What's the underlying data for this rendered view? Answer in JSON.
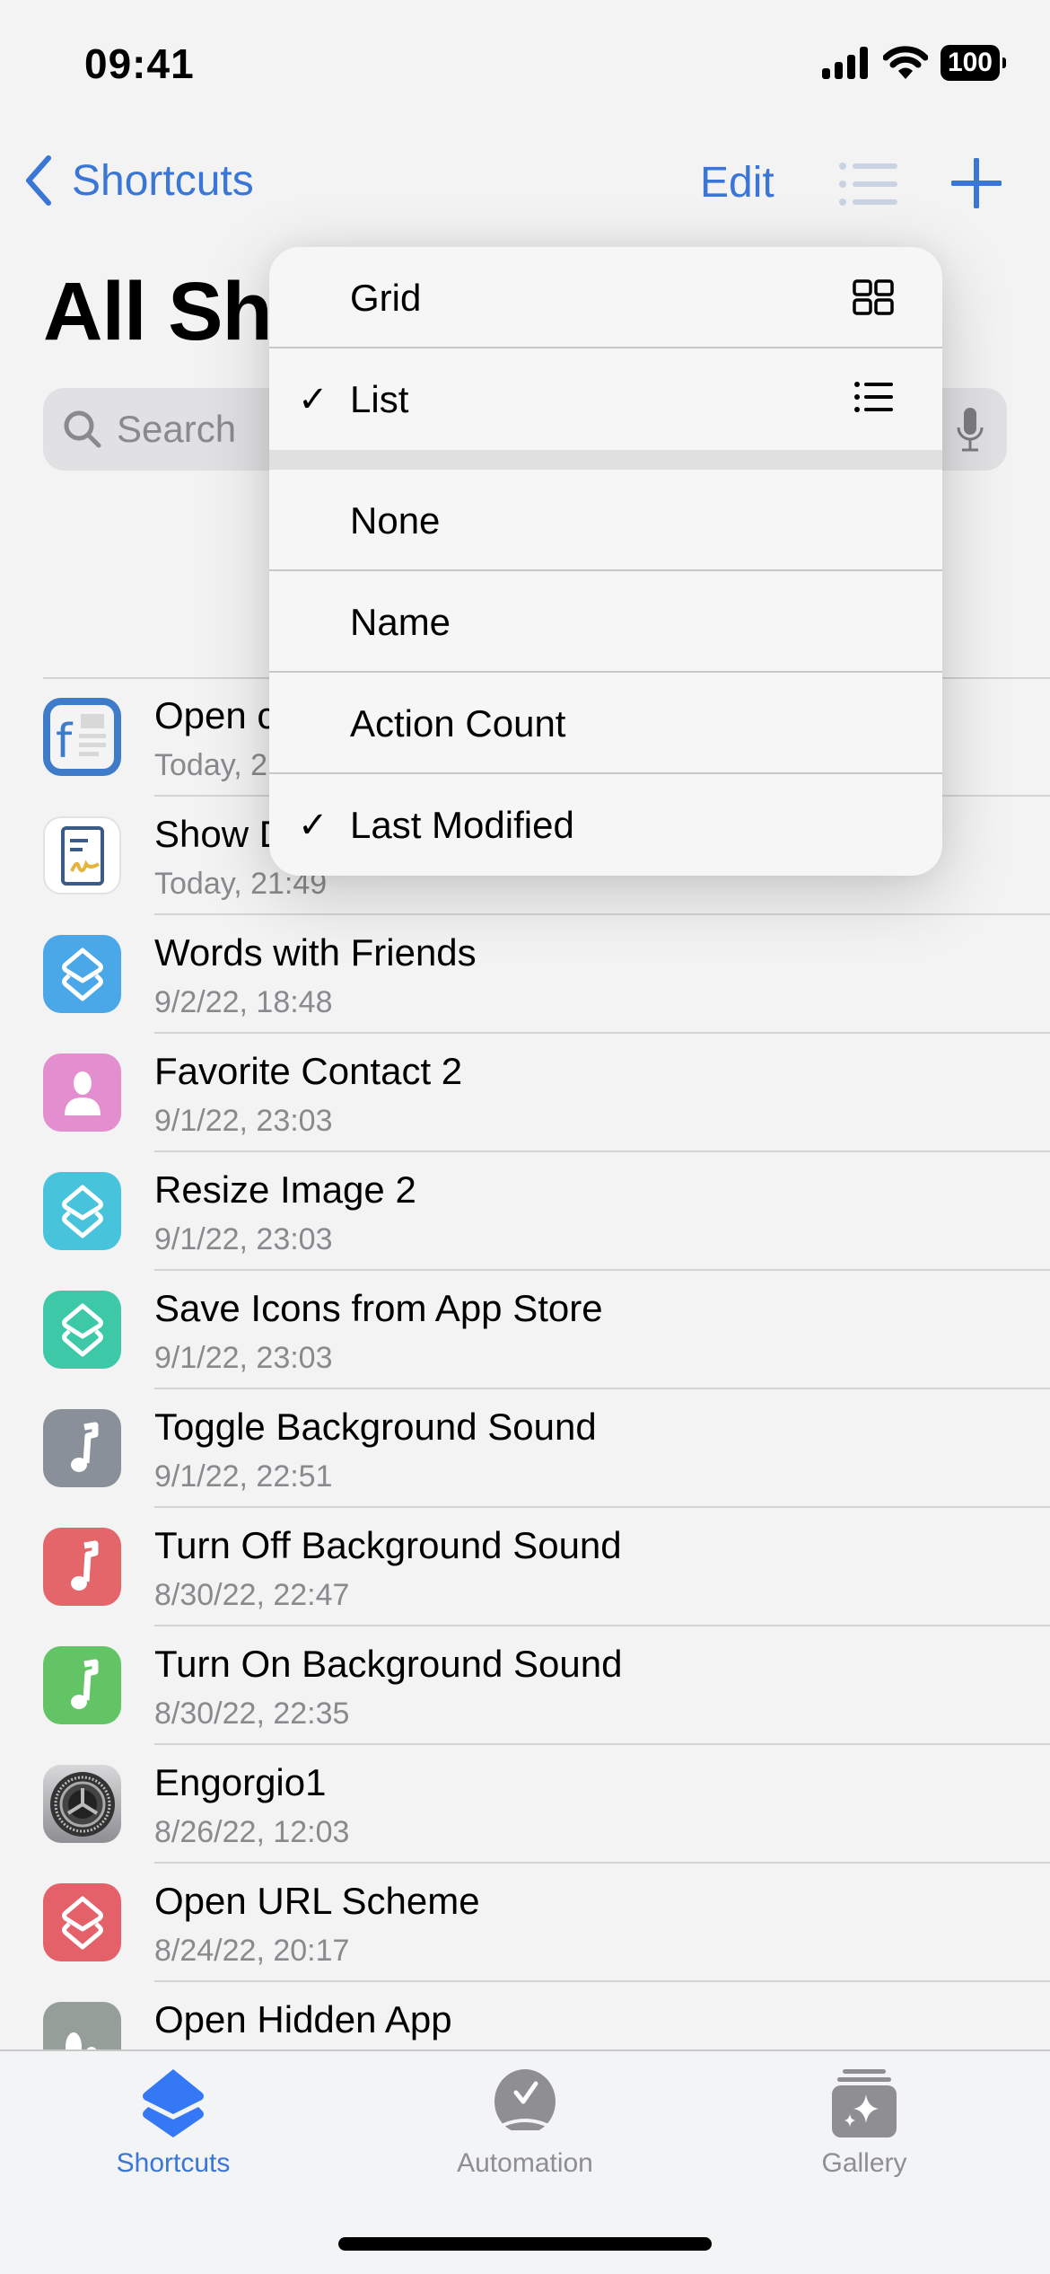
{
  "status_bar": {
    "time": "09:41",
    "battery": "100",
    "icons": [
      "signal-icon",
      "wifi-icon",
      "battery-icon"
    ]
  },
  "nav": {
    "back_label": "Shortcuts",
    "edit_label": "Edit",
    "view_icon": "list-view-icon",
    "add_icon": "plus-icon"
  },
  "page": {
    "title": "All Shortcuts",
    "title_visible": "All Sh"
  },
  "search": {
    "placeholder": "Search"
  },
  "menu": {
    "view_options": [
      {
        "label": "Grid",
        "checked": false,
        "icon": "grid-icon"
      },
      {
        "label": "List",
        "checked": true,
        "icon": "list-icon"
      }
    ],
    "sort_options": [
      {
        "label": "None",
        "checked": false
      },
      {
        "label": "Name",
        "checked": false
      },
      {
        "label": "Action Count",
        "checked": false
      },
      {
        "label": "Last Modified",
        "checked": true
      }
    ],
    "check_glyph": "✓"
  },
  "shortcuts": [
    {
      "name": "Open c",
      "date": "Today, 2",
      "icon": "app-document-icon",
      "color": "#3e7bc9"
    },
    {
      "name": "Show D",
      "date": "Today, 21:49",
      "icon": "signature-document-icon",
      "color": "#ffffff"
    },
    {
      "name": "Words with Friends",
      "date": "9/2/22, 18:48",
      "icon": "shortcuts-layers-icon",
      "color": "#4aa8e8"
    },
    {
      "name": "Favorite Contact 2",
      "date": "9/1/22, 23:03",
      "icon": "person-icon",
      "color": "#e38fcf"
    },
    {
      "name": "Resize Image 2",
      "date": "9/1/22, 23:03",
      "icon": "shortcuts-layers-icon",
      "color": "#47c3dc"
    },
    {
      "name": "Save Icons from App Store",
      "date": "9/1/22, 23:03",
      "icon": "shortcuts-layers-icon",
      "color": "#3dc9a8"
    },
    {
      "name": "Toggle Background Sound",
      "date": "9/1/22, 22:51",
      "icon": "music-note-icon",
      "color": "#8a9099"
    },
    {
      "name": "Turn Off Background Sound",
      "date": "8/30/22, 22:47",
      "icon": "music-note-icon",
      "color": "#e4666a"
    },
    {
      "name": "Turn On Background Sound",
      "date": "8/30/22, 22:35",
      "icon": "music-note-icon",
      "color": "#63c466"
    },
    {
      "name": "Engorgio1",
      "date": "8/26/22, 12:03",
      "icon": "settings-gear-icon",
      "color": "#9a9a9e"
    },
    {
      "name": "Open URL Scheme",
      "date": "8/24/22, 20:17",
      "icon": "shortcuts-layers-icon",
      "color": "#e5616a"
    },
    {
      "name": "Open Hidden App",
      "date": "",
      "icon": "footprints-icon",
      "color": "#959e98"
    }
  ],
  "tabbar": {
    "tabs": [
      {
        "label": "Shortcuts",
        "icon": "shortcuts-tab-icon",
        "active": true
      },
      {
        "label": "Automation",
        "icon": "automation-clock-icon",
        "active": false
      },
      {
        "label": "Gallery",
        "icon": "gallery-sparkle-icon",
        "active": false
      }
    ]
  },
  "colors": {
    "accent": "#3a76d6",
    "inactive_tab": "#8e8e93",
    "secondary_text": "#8a8a8e"
  }
}
